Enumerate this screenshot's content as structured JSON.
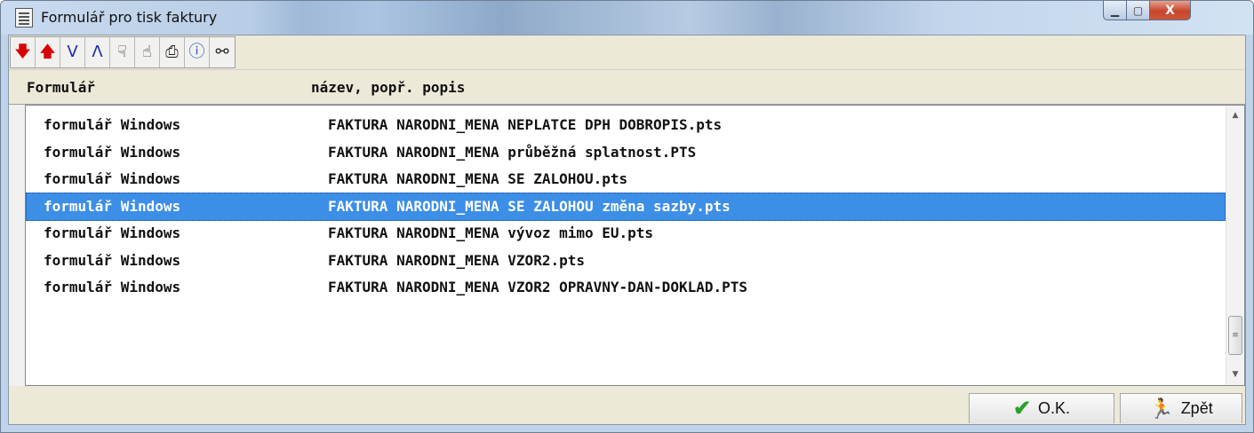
{
  "window": {
    "title": "Formulář pro tisk faktury"
  },
  "window_controls": {
    "minimize": "▁",
    "maximize": "▢",
    "close": "X"
  },
  "toolbar": {
    "buttons": [
      {
        "icon": "arrow-down-red-icon",
        "glyph": "🡇",
        "color": "#d80000"
      },
      {
        "icon": "arrow-up-red-icon",
        "glyph": "🡅",
        "color": "#d80000"
      },
      {
        "icon": "double-chevron-down-icon",
        "glyph": "V",
        "color": "#1c2bb0"
      },
      {
        "icon": "double-chevron-up-icon",
        "glyph": "Λ",
        "color": "#1c2bb0"
      },
      {
        "icon": "hand-pointing-down-icon",
        "glyph": "☟",
        "color": "#333333"
      },
      {
        "icon": "hand-pointing-up-icon",
        "glyph": "☝",
        "color": "#333333"
      },
      {
        "icon": "printer-icon",
        "glyph": "⎙",
        "color": "#222222"
      },
      {
        "icon": "info-icon",
        "glyph": "ⓘ",
        "color": "#2a4fb0"
      },
      {
        "icon": "binoculars-icon",
        "glyph": "⚯",
        "color": "#222222"
      }
    ]
  },
  "table": {
    "headers": [
      "Formulář",
      "název, popř. popis"
    ],
    "rows": [
      [
        "formulář Windows",
        "FAKTURA NARODNI_MENA NEPLATCE DPH DOBROPIS.pts"
      ],
      [
        "formulář Windows",
        "FAKTURA NARODNI_MENA průběžná splatnost.PTS"
      ],
      [
        "formulář Windows",
        "FAKTURA NARODNI_MENA SE ZALOHOU.pts"
      ],
      [
        "formulář Windows",
        "FAKTURA NARODNI_MENA SE ZALOHOU změna sazby.pts"
      ],
      [
        "formulář Windows",
        "FAKTURA NARODNI_MENA vývoz mimo EU.pts"
      ],
      [
        "formulář Windows",
        "FAKTURA NARODNI_MENA VZOR2.pts"
      ],
      [
        "formulář Windows",
        "FAKTURA NARODNI_MENA VZOR2 OPRAVNY-DAN-DOKLAD.PTS"
      ]
    ],
    "selected_index": 3,
    "selection_color": "#3d8ee6"
  },
  "scrollbar": {
    "up_glyph": "▲",
    "down_glyph": "▼",
    "thumb_grip": "≡"
  },
  "footer": {
    "ok": {
      "label": "O.K.",
      "icon": "checkmark-icon",
      "glyph": "✔"
    },
    "back": {
      "label": "Zpět",
      "icon": "running-man-icon",
      "glyph": "🏃"
    }
  }
}
